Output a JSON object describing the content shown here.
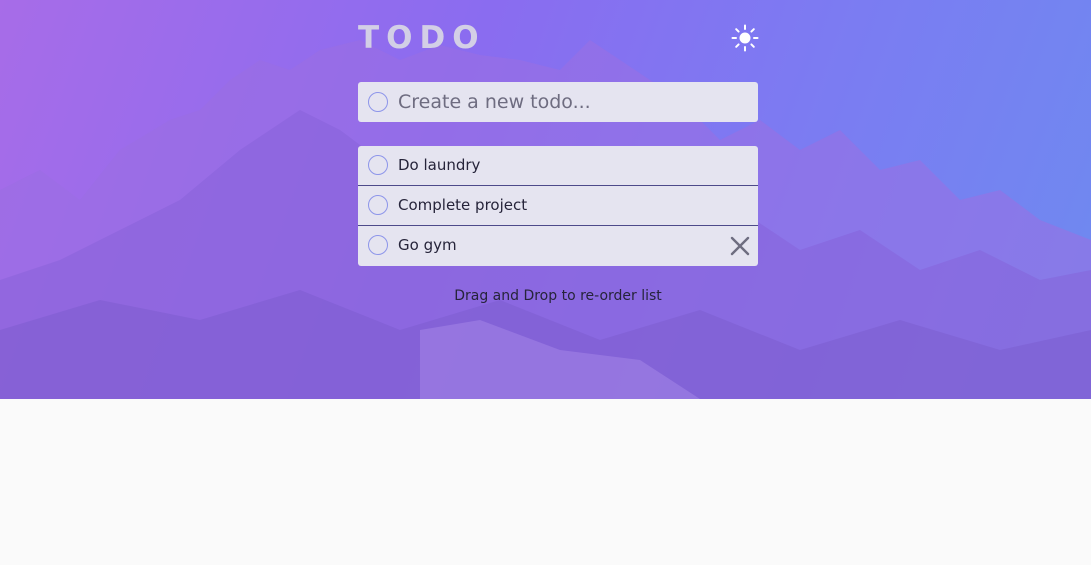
{
  "header": {
    "title": "TODO",
    "theme_icon": "sun-icon"
  },
  "create": {
    "placeholder": "Create a new todo..."
  },
  "todos": [
    {
      "text": "Do laundry"
    },
    {
      "text": "Complete project"
    },
    {
      "text": "Go gym"
    }
  ],
  "footer": {
    "hint": "Drag and Drop to re-order list"
  },
  "colors": {
    "accent": "#8d95ea",
    "card": "#e5e4f0",
    "background": "#fafafa"
  }
}
